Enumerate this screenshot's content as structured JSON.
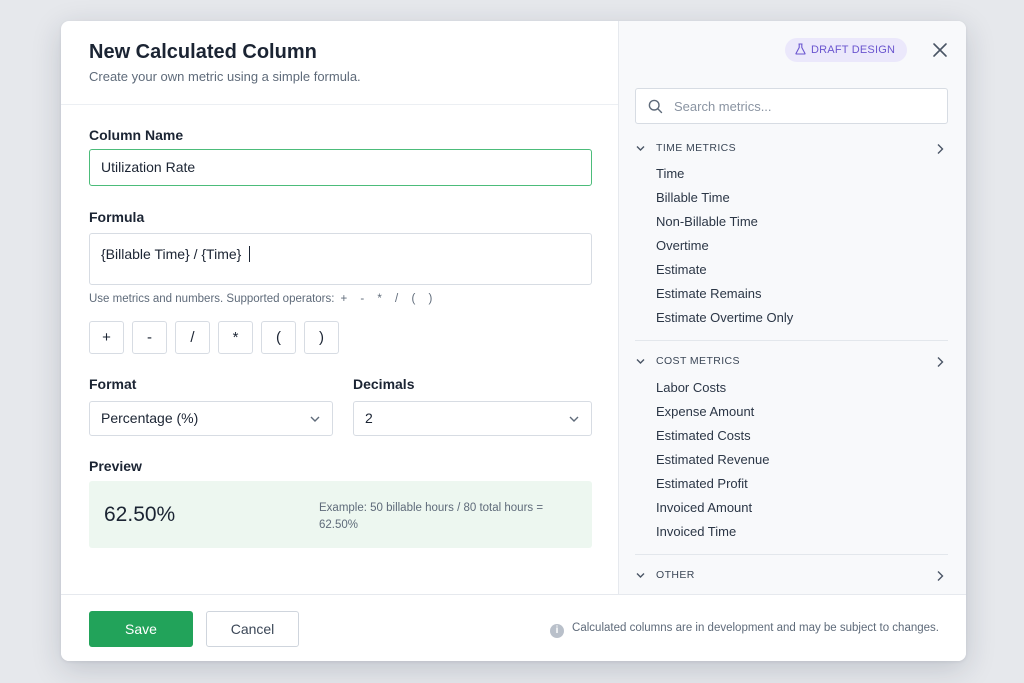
{
  "dialog": {
    "title": "New Calculated Column",
    "subtitle": "Create your own metric using a simple formula."
  },
  "form": {
    "column_name_label": "Column Name",
    "column_name_value": "Utilization Rate",
    "formula_label": "Formula",
    "formula_value": "{Billable Time} / {Time}",
    "hint_text": "Use metrics and numbers. Supported operators:",
    "hint_operators": "+ - * / ( )",
    "operator_buttons": [
      "+",
      "-",
      "/",
      "*",
      "(",
      ")"
    ],
    "format_label": "Format",
    "format_value": "Percentage (%)",
    "decimals_label": "Decimals",
    "decimals_value": "2",
    "preview_label": "Preview",
    "preview_value": "62.50%",
    "preview_example": "Example: 50 billable hours / 80 total hours = 62.50%"
  },
  "footer": {
    "save_label": "Save",
    "cancel_label": "Cancel",
    "note": "Calculated columns are in development and may be subject to changes."
  },
  "sidebar": {
    "badge": "DRAFT DESIGN",
    "search_placeholder": "Search metrics...",
    "groups": [
      {
        "title": "TIME METRICS",
        "items": [
          "Time",
          "Billable Time",
          "Non-Billable Time",
          "Overtime",
          "Estimate",
          "Estimate Remains",
          "Estimate Overtime Only"
        ]
      },
      {
        "title": "COST METRICS",
        "items": [
          "Labor Costs",
          "Expense Amount",
          "Estimated Costs",
          "Estimated Revenue",
          "Estimated Profit",
          "Invoiced Amount",
          "Invoiced Time"
        ]
      },
      {
        "title": "OTHER",
        "items": []
      }
    ]
  },
  "colors": {
    "accent_green": "#22a35a",
    "input_focus_border": "#4cbc7a",
    "preview_background": "#edf7f0",
    "badge_background": "#ebe8fb",
    "badge_text": "#6a55cf"
  },
  "icons": [
    "flask-icon",
    "close-icon",
    "search-icon",
    "chevron-down-icon",
    "chevron-right-icon",
    "info-icon"
  ]
}
